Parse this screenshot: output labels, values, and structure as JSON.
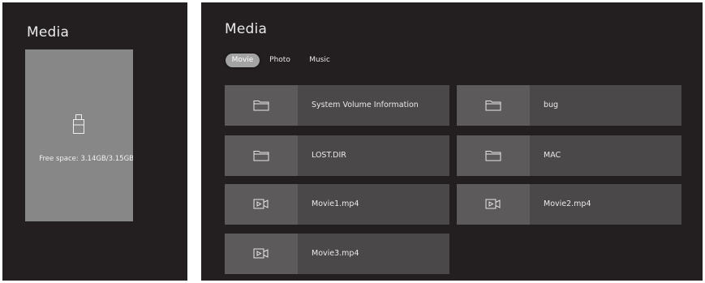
{
  "left_panel": {
    "title": "Media",
    "storage": {
      "icon": "usb-drive-icon",
      "text": "Free space: 3.14GB/3.15GB"
    }
  },
  "right_panel": {
    "title": "Media",
    "tabs": [
      {
        "label": "Movie",
        "active": true
      },
      {
        "label": "Photo",
        "active": false
      },
      {
        "label": "Music",
        "active": false
      }
    ],
    "items": [
      {
        "name": "System Volume Information",
        "type": "folder",
        "icon": "folder-icon"
      },
      {
        "name": "bug",
        "type": "folder",
        "icon": "folder-icon"
      },
      {
        "name": "LOST.DIR",
        "type": "folder",
        "icon": "folder-icon"
      },
      {
        "name": "MAC",
        "type": "folder",
        "icon": "folder-icon"
      },
      {
        "name": "Movie1.mp4",
        "type": "video",
        "icon": "video-file-icon"
      },
      {
        "name": "Movie2.mp4",
        "type": "video",
        "icon": "video-file-icon"
      },
      {
        "name": "Movie3.mp4",
        "type": "video",
        "icon": "video-file-icon"
      }
    ]
  },
  "colors": {
    "panel_bg": "#231f20",
    "card_bg": "#878787",
    "item_bg": "#4b4849",
    "item_icon_bg": "#5d5a5b",
    "active_tab_bg": "#a3a3a3"
  }
}
